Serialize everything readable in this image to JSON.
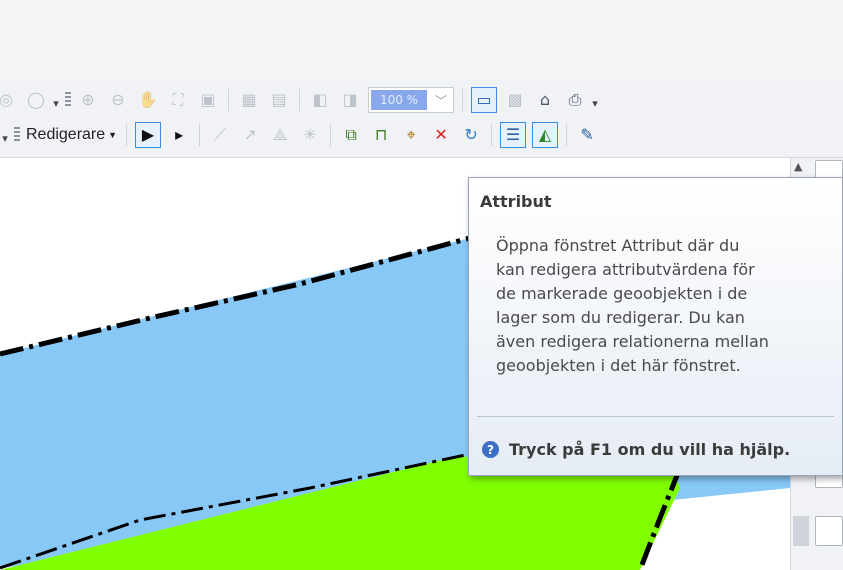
{
  "toolbar_row1": {
    "zoom_value": "100 %",
    "icons": [
      "rotate-icon",
      "zoom-in-fixed-icon",
      "zoom-out-fixed-icon",
      "pan-icon",
      "full-extent-icon",
      "page-icon",
      "grid-icon",
      "grid-fit-icon",
      "back-icon",
      "forward-icon",
      "page-layout-icon",
      "print-icon",
      "map-document-icon",
      "export-icon"
    ]
  },
  "toolbar_row2": {
    "editor_menu_label": "Redigerare",
    "icons": [
      "edit-tool-icon",
      "edit-annotation-icon",
      "straight-segment-icon",
      "trace-icon",
      "construct-icon",
      "split-icon",
      "edit-vertices-icon",
      "reshape-icon",
      "cut-polygons-icon",
      "split-tool-icon",
      "rotate-tool-icon",
      "attributes-icon",
      "sketch-properties-icon",
      "create-features-icon"
    ]
  },
  "tooltip": {
    "title": "Attribut",
    "body_lines": [
      "Öppna fönstret Attribut där du",
      "kan redigera attributvärdena för",
      "de markerade geoobjekten i de",
      "lager som du redigerar. Du kan",
      "även redigera relationerna mellan",
      "geoobjekten i det här fönstret."
    ],
    "help_text": "Tryck på F1 om du vill ha hjälp."
  },
  "map": {
    "colors": {
      "blue_polygon": "#88c8f7",
      "green_polygon": "#80ff00",
      "outline": "#000000"
    }
  }
}
